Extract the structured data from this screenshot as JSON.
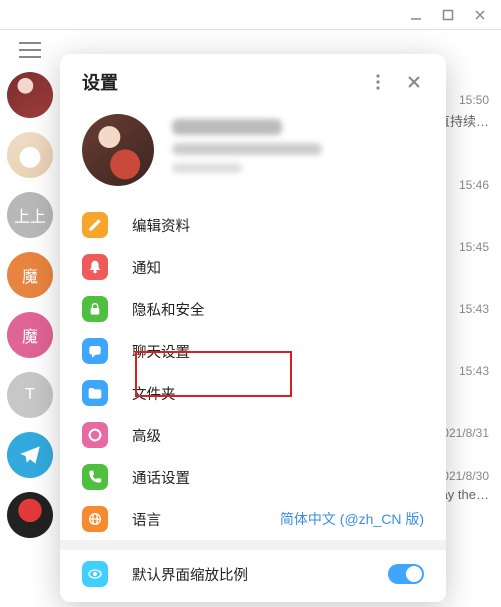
{
  "window": {},
  "sidebar": {
    "avatars": [
      {
        "label": "",
        "bg": "art1"
      },
      {
        "label": "",
        "bg": "art2"
      },
      {
        "label": "上上",
        "color": "#b8b8b8"
      },
      {
        "label": "魔",
        "color": "#e8843f"
      },
      {
        "label": "魔",
        "color": "#e06494"
      },
      {
        "label": "T",
        "color": "#c7c7c7"
      },
      {
        "label": "",
        "bg": "art-tg"
      },
      {
        "label": "",
        "bg": "art-red"
      }
    ]
  },
  "chats": [
    {
      "time": "15:50",
      "preview": "直持续…"
    },
    {
      "time": "15:46",
      "preview": ""
    },
    {
      "time": "15:45",
      "preview": ""
    },
    {
      "time": "15:43",
      "preview": ""
    },
    {
      "time": "15:43",
      "preview": ""
    },
    {
      "time": "021/8/31",
      "preview": ""
    },
    {
      "time": "021/8/30",
      "preview": "ay the…"
    },
    {
      "time": "",
      "preview": ""
    }
  ],
  "settings": {
    "title": "设置",
    "profile": {
      "name_hidden": true,
      "phone_hidden": true,
      "status_hidden": true
    },
    "menu": [
      {
        "id": "edit-profile",
        "label": "编辑资料",
        "icon": "pencil",
        "bg": "#f7a52f"
      },
      {
        "id": "notifications",
        "label": "通知",
        "icon": "bell",
        "bg": "#ef5b5b"
      },
      {
        "id": "privacy-security",
        "label": "隐私和安全",
        "icon": "lock",
        "bg": "#4fbf3f",
        "highlighted": true
      },
      {
        "id": "chat-settings",
        "label": "聊天设置",
        "icon": "chat",
        "bg": "#3fa6ff"
      },
      {
        "id": "folders",
        "label": "文件夹",
        "icon": "folder",
        "bg": "#3fa6ff"
      },
      {
        "id": "advanced",
        "label": "高级",
        "icon": "wrench",
        "bg": "#e86aa4"
      },
      {
        "id": "calls",
        "label": "通话设置",
        "icon": "phone",
        "bg": "#4fbf3f"
      },
      {
        "id": "language",
        "label": "语言",
        "icon": "globe",
        "bg": "#f78a2f",
        "extra": "简体中文 (@zh_CN 版)"
      }
    ],
    "scale": {
      "label": "默认界面缩放比例",
      "icon": "eye",
      "bg": "#3fd0ff",
      "on": true
    }
  }
}
